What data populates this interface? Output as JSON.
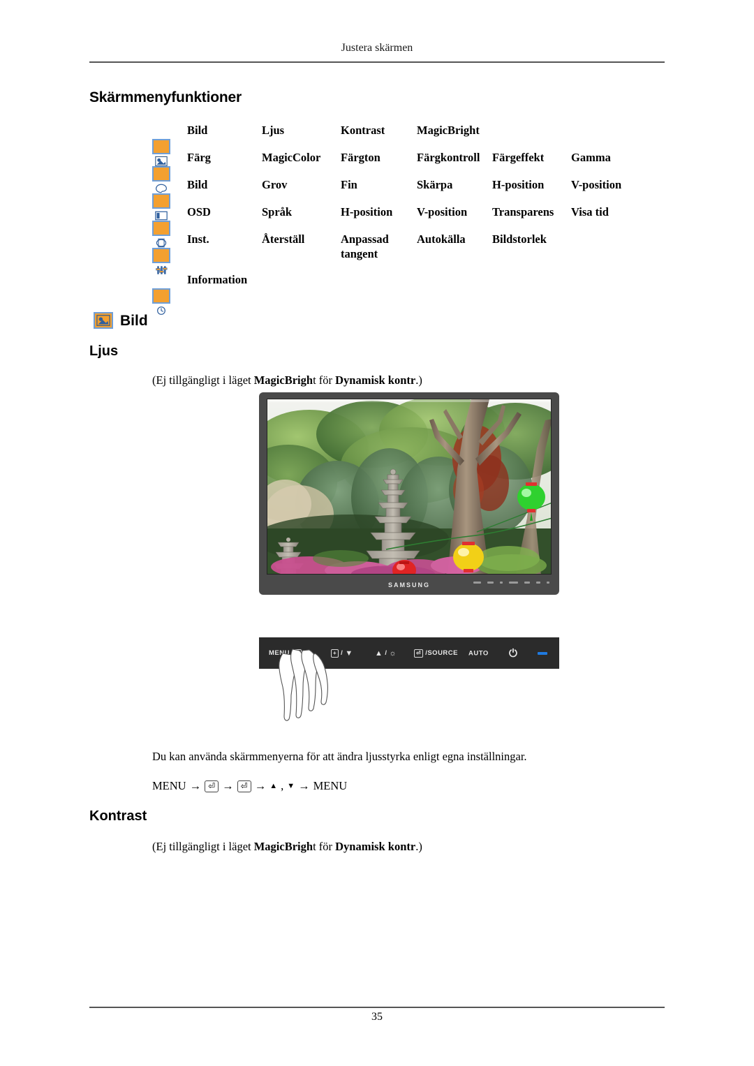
{
  "header": {
    "running_title": "Justera skärmen",
    "page_number": "35"
  },
  "sections": {
    "osd_functions_title": "Skärmmenyfunktioner",
    "bild_title": "Bild",
    "ljus_title": "Ljus",
    "kontrast_title": "Kontrast"
  },
  "menu_table": {
    "rows": [
      {
        "icon": "picture-icon",
        "label": "Bild",
        "items": [
          "Ljus",
          "Kontrast",
          "MagicBright",
          "",
          "",
          ""
        ]
      },
      {
        "icon": "color-palette-icon",
        "label": "Färg",
        "items": [
          "MagicColor",
          "Färgton",
          "Färgkontroll",
          "Färgeffekt",
          "Gamma",
          ""
        ]
      },
      {
        "icon": "image-geometry-icon",
        "label": "Bild",
        "items": [
          "Grov",
          "Fin",
          "Skärpa",
          "H-position",
          "V-position",
          ""
        ]
      },
      {
        "icon": "osd-icon",
        "label": "OSD",
        "items": [
          "Språk",
          "H-position",
          "V-position",
          "Transparens",
          "Visa tid",
          ""
        ]
      },
      {
        "icon": "settings-sliders-icon",
        "label": "Inst.",
        "items": [
          "Återställ",
          "Anpassad\ntangent",
          "Autokälla",
          "Bildstorlek",
          "",
          ""
        ]
      },
      {
        "icon": "information-clock-icon",
        "label": "Information",
        "items": [
          "",
          "",
          "",
          "",
          "",
          ""
        ]
      }
    ]
  },
  "notes": {
    "ljus_note_prefix": "(Ej tillgängligt i läget ",
    "ljus_note_bold1": "MagicBrigh",
    "ljus_note_mid": "t för ",
    "ljus_note_bold2": "Dynamisk kontr",
    "ljus_note_suffix": ".)",
    "kontrast_note_prefix": "(Ej tillgängligt i läget ",
    "kontrast_note_bold1": "MagicBrigh",
    "kontrast_note_mid": "t för ",
    "kontrast_note_bold2": "Dynamisk kontr",
    "kontrast_note_suffix": ".)"
  },
  "monitor": {
    "brand": "SAMSUNG",
    "screen_description": "garden-photo"
  },
  "control_panel": {
    "buttons": [
      {
        "name": "menu-button",
        "label": "MENU"
      },
      {
        "name": "down-brightness-button",
        "label": "/"
      },
      {
        "name": "up-brightness-button",
        "label": "/"
      },
      {
        "name": "enter-source-button",
        "label": "/SOURCE"
      },
      {
        "name": "auto-button",
        "label": "AUTO"
      },
      {
        "name": "power-button",
        "label": ""
      }
    ],
    "power_indicator_color": "#1f7ae0"
  },
  "body": {
    "ljus_description": "Du kan använda skärmmenyerna för att ändra ljusstyrka enligt egna inställningar.",
    "key_sequence": {
      "start": "MENU",
      "arrow": "→",
      "comma": ",",
      "end": "MENU"
    }
  }
}
